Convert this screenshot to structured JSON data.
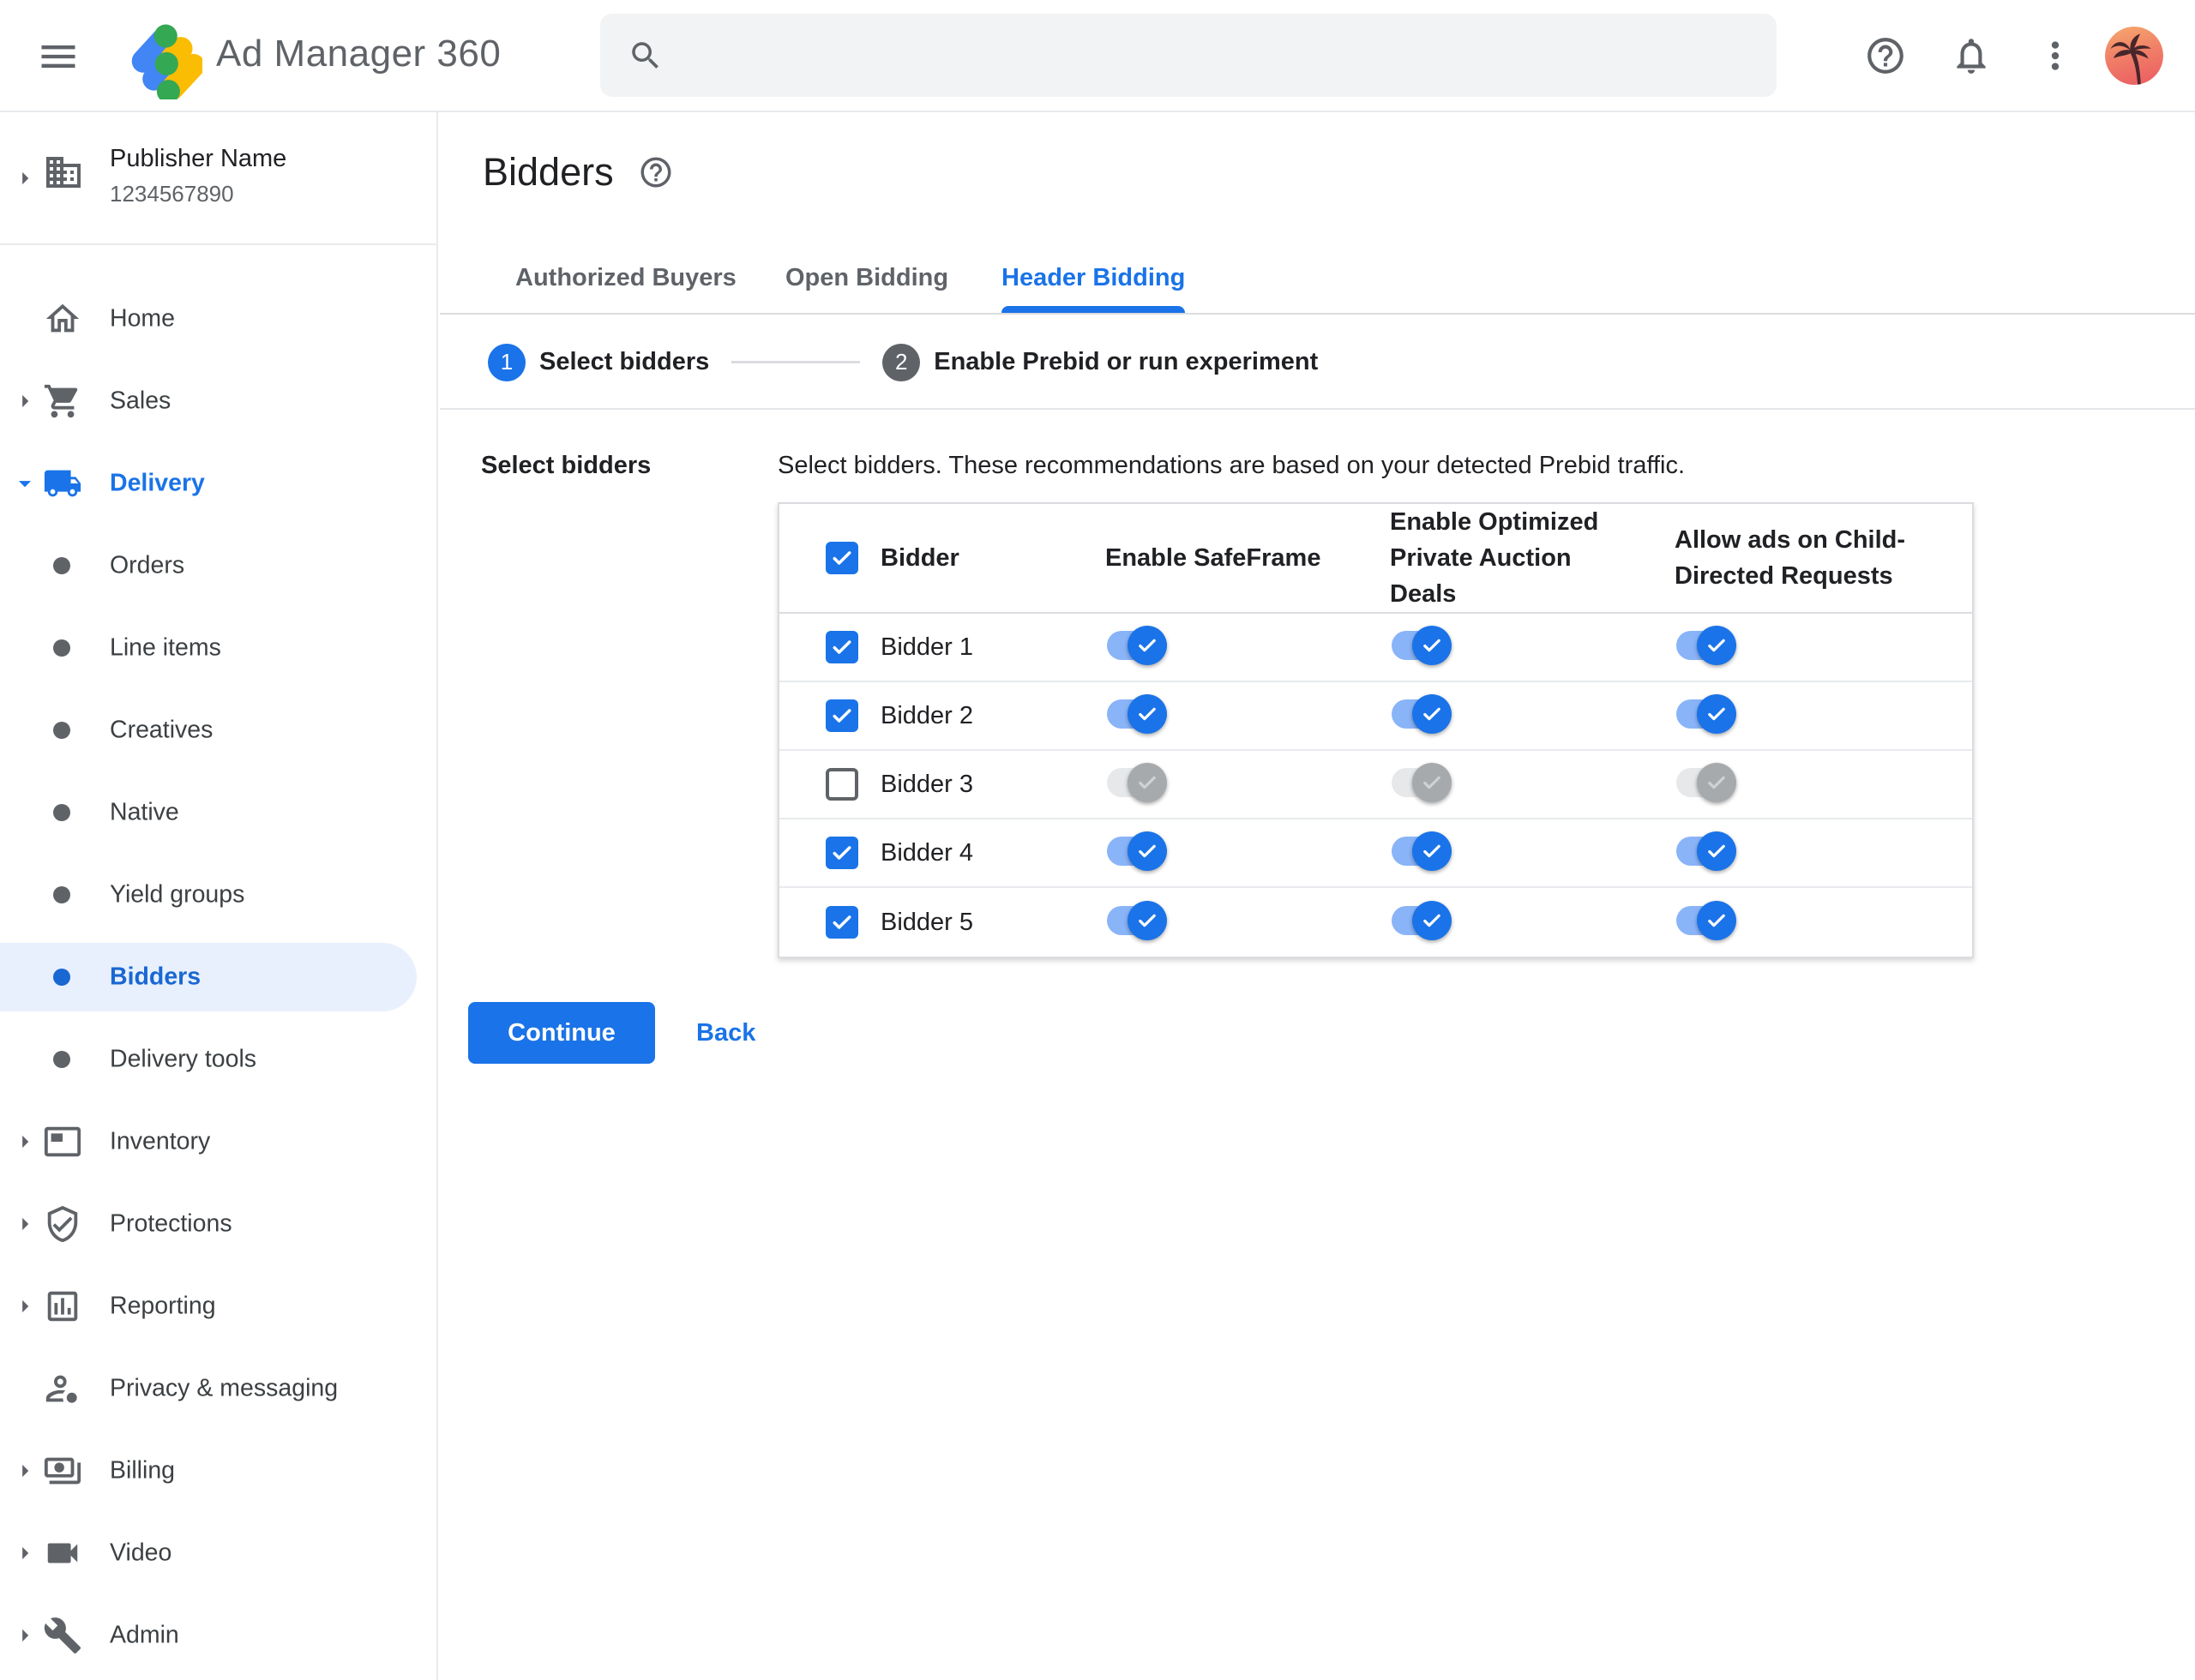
{
  "header": {
    "product_name": "Ad Manager 360"
  },
  "account": {
    "publisher_name": "Publisher Name",
    "publisher_id": "1234567890"
  },
  "sidebar": {
    "items": [
      {
        "label": "Home"
      },
      {
        "label": "Sales"
      },
      {
        "label": "Delivery",
        "expanded": true
      },
      {
        "label": "Orders"
      },
      {
        "label": "Line items"
      },
      {
        "label": "Creatives"
      },
      {
        "label": "Native"
      },
      {
        "label": "Yield groups"
      },
      {
        "label": "Bidders",
        "selected": true
      },
      {
        "label": "Delivery tools"
      },
      {
        "label": "Inventory"
      },
      {
        "label": "Protections"
      },
      {
        "label": "Reporting"
      },
      {
        "label": "Privacy & messaging"
      },
      {
        "label": "Billing"
      },
      {
        "label": "Video"
      },
      {
        "label": "Admin"
      }
    ]
  },
  "page": {
    "title": "Bidders"
  },
  "tabs": [
    {
      "label": "Authorized Buyers",
      "active": false
    },
    {
      "label": "Open Bidding",
      "active": false
    },
    {
      "label": "Header Bidding",
      "active": true
    }
  ],
  "stepper": {
    "steps": [
      {
        "number": "1",
        "label": "Select bidders",
        "active": true
      },
      {
        "number": "2",
        "label": "Enable Prebid or run experiment",
        "active": false
      }
    ]
  },
  "form": {
    "label": "Select bidders",
    "description": "Select bidders. These recommendations are based on your detected Prebid traffic."
  },
  "table": {
    "columns": [
      "Bidder",
      "Enable SafeFrame",
      "Enable Optimized Private Auction Deals",
      "Allow ads on Child-Directed Requests"
    ],
    "header_checkbox_checked": true,
    "rows": [
      {
        "name": "Bidder 1",
        "selected": true,
        "enable_safeframe": true,
        "enable_optimized_private_auction_deals": true,
        "allow_ads_child_directed": true
      },
      {
        "name": "Bidder 2",
        "selected": true,
        "enable_safeframe": true,
        "enable_optimized_private_auction_deals": true,
        "allow_ads_child_directed": true
      },
      {
        "name": "Bidder 3",
        "selected": false,
        "enable_safeframe": false,
        "enable_optimized_private_auction_deals": false,
        "allow_ads_child_directed": false
      },
      {
        "name": "Bidder 4",
        "selected": true,
        "enable_safeframe": true,
        "enable_optimized_private_auction_deals": true,
        "allow_ads_child_directed": true
      },
      {
        "name": "Bidder 5",
        "selected": true,
        "enable_safeframe": true,
        "enable_optimized_private_auction_deals": true,
        "allow_ads_child_directed": true
      }
    ]
  },
  "actions": {
    "continue_label": "Continue",
    "back_label": "Back"
  },
  "colors": {
    "accent": "#1a73e8",
    "accent_light": "#8ab4f8",
    "selected_pill_bg": "#e8f0fe",
    "border": "#dadce0",
    "text_primary": "#202124",
    "text_secondary": "#5f6368",
    "disabled_track": "#e6e8ea",
    "disabled_thumb": "#a7aaad"
  }
}
